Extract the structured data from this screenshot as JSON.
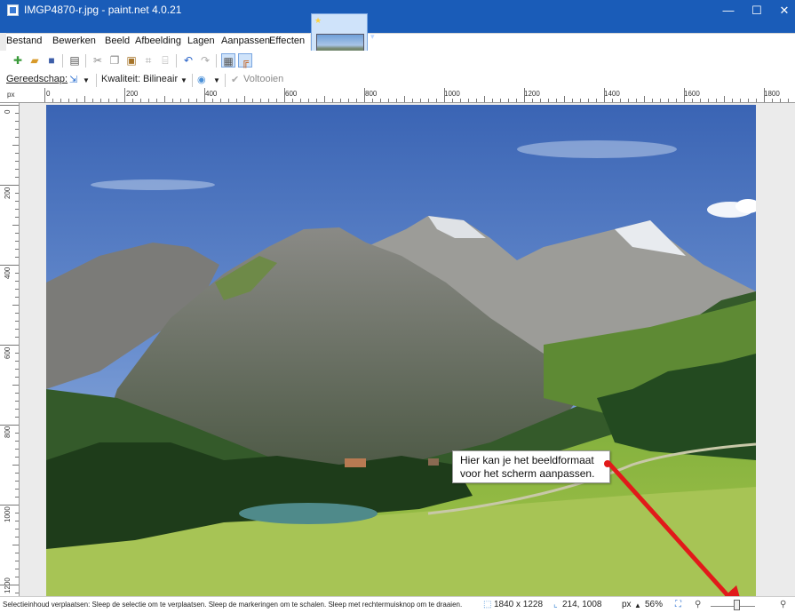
{
  "window": {
    "title": "IMGP4870-r.jpg - paint.net 4.0.21",
    "minimize": "—",
    "maximize": "☐",
    "close": "✕"
  },
  "menu": {
    "items": [
      {
        "label": "Bestand"
      },
      {
        "label": "Bewerken"
      },
      {
        "label": "Beeld"
      },
      {
        "label": "Afbeelding"
      },
      {
        "label": "Lagen"
      },
      {
        "label": "Aanpassen"
      },
      {
        "label": "Effecten"
      }
    ]
  },
  "image_tab": {
    "star": "★",
    "dropdown": "▾"
  },
  "toolbar": {
    "icons": [
      "new-icon",
      "open-icon",
      "save-icon",
      "print-icon",
      "cut-icon",
      "copy-icon",
      "paste-icon",
      "crop-icon",
      "deselect-icon",
      "undo-icon",
      "redo-icon",
      "grid-icon",
      "rulers-icon"
    ]
  },
  "toolbar2": {
    "tool_label": "Gereedschap:",
    "quality_label": "Kwaliteit:",
    "quality_value": "Bilineair",
    "finish_label": "Voltooien"
  },
  "ruler": {
    "unit": "px",
    "h_labels": [
      "0",
      "200",
      "400",
      "600",
      "800",
      "1000",
      "1200",
      "1400",
      "1600",
      "1800"
    ],
    "v_labels": [
      "0",
      "200",
      "400",
      "600",
      "800",
      "1000",
      "1200"
    ]
  },
  "callout": {
    "line1": "Hier kan je het beeldformaat",
    "line2": "voor het scherm aanpassen."
  },
  "status": {
    "message": "Selectieinhoud verplaatsen: Sleep de selectie om te verplaatsen. Sleep de markeringen om te schalen. Sleep met rechtermuisknop om te draaien.",
    "image_size": "1840 x 1228",
    "cursor_pos": "214, 1008",
    "unit": "px",
    "zoom": "56%"
  },
  "colors": {
    "titlebar": "#1a5cb8",
    "arrow": "#e11a1a"
  }
}
